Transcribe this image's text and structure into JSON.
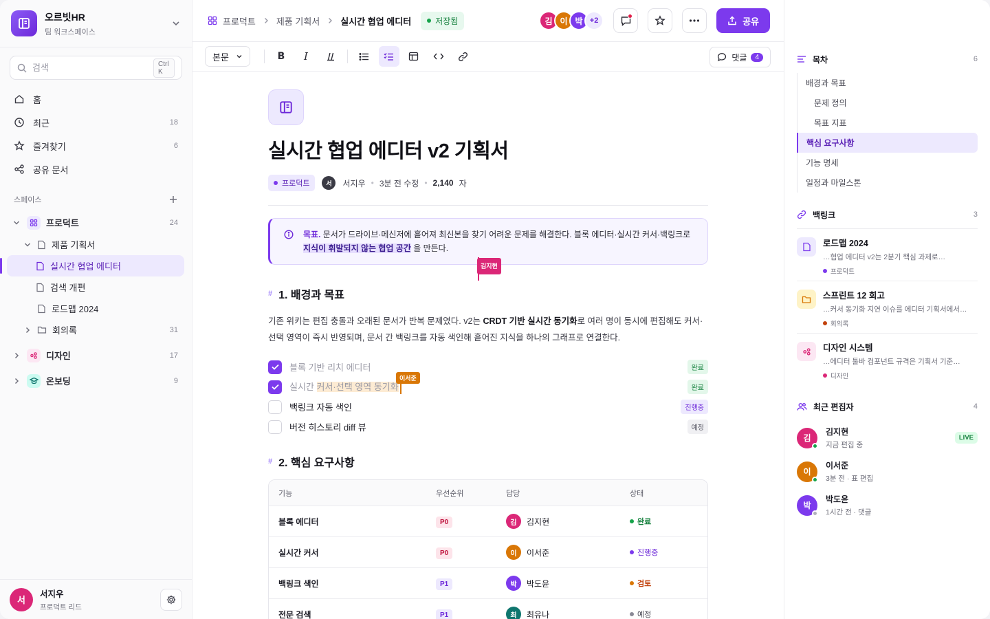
{
  "workspace": {
    "name": "오르빗HR",
    "sub": "팀 워크스페이스"
  },
  "search": {
    "placeholder": "검색",
    "shortcut": "Ctrl K"
  },
  "nav": [
    {
      "label": "홈",
      "count": "",
      "icon": "home-icon"
    },
    {
      "label": "최근",
      "count": "18",
      "icon": "clock-icon"
    },
    {
      "label": "즐겨찾기",
      "count": "6",
      "icon": "star-icon"
    },
    {
      "label": "공유 문서",
      "count": "",
      "icon": "share-icon"
    }
  ],
  "spaces": {
    "heading": "스페이스",
    "product": {
      "label": "프로덕트",
      "count": "24"
    },
    "spec_folder": "제품 기획서",
    "pages": [
      "실시간 협업 에디터",
      "검색 개편",
      "로드맵 2024"
    ],
    "meetings": {
      "label": "회의록",
      "count": "31"
    },
    "design": {
      "label": "디자인",
      "count": "17"
    },
    "onboarding": {
      "label": "온보딩",
      "count": "9"
    }
  },
  "user": {
    "initial": "서",
    "name": "서지우",
    "role": "프로덕트 리드"
  },
  "breadcrumb": [
    "프로덕트",
    "제품 기획서",
    "실시간 협업 에디터"
  ],
  "saved_label": "저장됨",
  "presence": {
    "avatars": [
      "김",
      "이",
      "박"
    ],
    "more": "+2"
  },
  "share_label": "공유",
  "toolbar": {
    "style": "본문",
    "comments_label": "댓글",
    "comments_count": "4"
  },
  "doc": {
    "title": "실시간 협업 에디터 v2 기획서",
    "tag": "프로덕트",
    "author_initial": "서",
    "author": "서지우",
    "edited": "3분 전 수정",
    "chars": "2,140",
    "chars_unit": "자",
    "callout": {
      "label": "목표.",
      "text": "문서가 드라이브·메신저에 흩어져 최신본을 찾기 어려운 문제를 해결한다. 블록 에디터·실시간 커서·백링크로",
      "highlight": "지식이 휘발되지 않는 협업 공간",
      "tail": "을 만든다."
    },
    "cursor1": "김지현",
    "cursor2": "이서준",
    "section1": "1. 배경과 목표",
    "para": {
      "a": "기존 위키는 편집 충돌과 오래된 문서가 반복 문제였다. v2는 ",
      "bold": "CRDT 기반 실시간 동기화",
      "b": "로 여러 명이 동시에 편집해도 커서·선택 영역이 즉시 반영되며, 문서 간 백링크를 자동 색인해 흩어진 지식을 하나의 그래프로 연결한다."
    },
    "tasks": [
      {
        "text": "블록 기반 리치 에디터",
        "status": "완료"
      },
      {
        "prefix": "실시간 ",
        "highlight": "커서·선택 영역 동기화",
        "status": "완료"
      },
      {
        "text": "백링크 자동 색인",
        "status": "진행중"
      },
      {
        "text": "버전 히스토리 diff 뷰",
        "status": "예정"
      }
    ],
    "section2": "2. 핵심 요구사항",
    "table": {
      "headers": [
        "기능",
        "우선순위",
        "담당",
        "상태"
      ],
      "rows": [
        {
          "feature": "블록 에디터",
          "priority": "P0",
          "owner_initial": "김",
          "owner": "김지현",
          "status": "완료"
        },
        {
          "feature": "실시간 커서",
          "priority": "P0",
          "owner_initial": "이",
          "owner": "이서준",
          "status": "진행중"
        },
        {
          "feature": "백링크 색인",
          "priority": "P1",
          "owner_initial": "박",
          "owner": "박도윤",
          "status": "검토"
        },
        {
          "feature": "전문 검색",
          "priority": "P1",
          "owner_initial": "최",
          "owner": "최유나",
          "status": "예정"
        }
      ]
    }
  },
  "toc": {
    "heading": "목차",
    "count": "6",
    "items": [
      "배경과 목표",
      "문제 정의",
      "목표 지표",
      "핵심 요구사항",
      "기능 명세",
      "일정과 마일스톤"
    ]
  },
  "backlinks": {
    "heading": "백링크",
    "count": "3",
    "items": [
      {
        "title": "로드맵 2024",
        "excerpt": "…협업 에디터 v2는 2분기 핵심 과제로…",
        "space": "프로덕트"
      },
      {
        "title": "스프린트 12 회고",
        "excerpt": "…커서 동기화 지연 이슈를 에디터 기획서에서…",
        "space": "회의록"
      },
      {
        "title": "디자인 시스템",
        "excerpt": "…에디터 툴바 컴포넌트 규격은 기획서 기준…",
        "space": "디자인"
      }
    ]
  },
  "editors": {
    "heading": "최근 편집자",
    "count": "4",
    "items": [
      {
        "initial": "김",
        "name": "김지현",
        "status": "지금 편집 중",
        "badge": "LIVE"
      },
      {
        "initial": "이",
        "name": "이서준",
        "status": "3분 전 · 표 편집"
      },
      {
        "initial": "박",
        "name": "박도윤",
        "status": "1시간 전 · 댓글"
      }
    ]
  },
  "colors": {
    "accent": "#7c3aed",
    "green": "#16a34a",
    "pink": "#db2777",
    "orange": "#d97706",
    "purple": "#7c3aed",
    "teal": "#0f766e"
  }
}
